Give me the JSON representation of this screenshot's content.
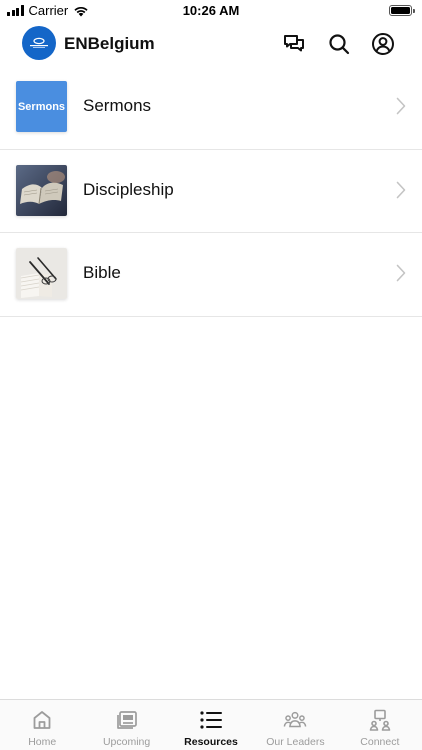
{
  "status_bar": {
    "carrier": "Carrier",
    "time": "10:26 AM"
  },
  "header": {
    "title": "ENBelgium",
    "logo_color": "#1466c8",
    "actions": [
      "chat-icon",
      "search-icon",
      "profile-icon"
    ]
  },
  "resources": [
    {
      "label": "Sermons",
      "thumb_text": "Sermons",
      "thumb_color": "#4a8ee0"
    },
    {
      "label": "Discipleship"
    },
    {
      "label": "Bible"
    }
  ],
  "tabs": [
    {
      "label": "Home",
      "icon": "home-icon",
      "active": false
    },
    {
      "label": "Upcoming",
      "icon": "upcoming-icon",
      "active": false
    },
    {
      "label": "Resources",
      "icon": "list-icon",
      "active": true
    },
    {
      "label": "Our Leaders",
      "icon": "leaders-icon",
      "active": false
    },
    {
      "label": "Connect",
      "icon": "connect-icon",
      "active": false
    }
  ]
}
